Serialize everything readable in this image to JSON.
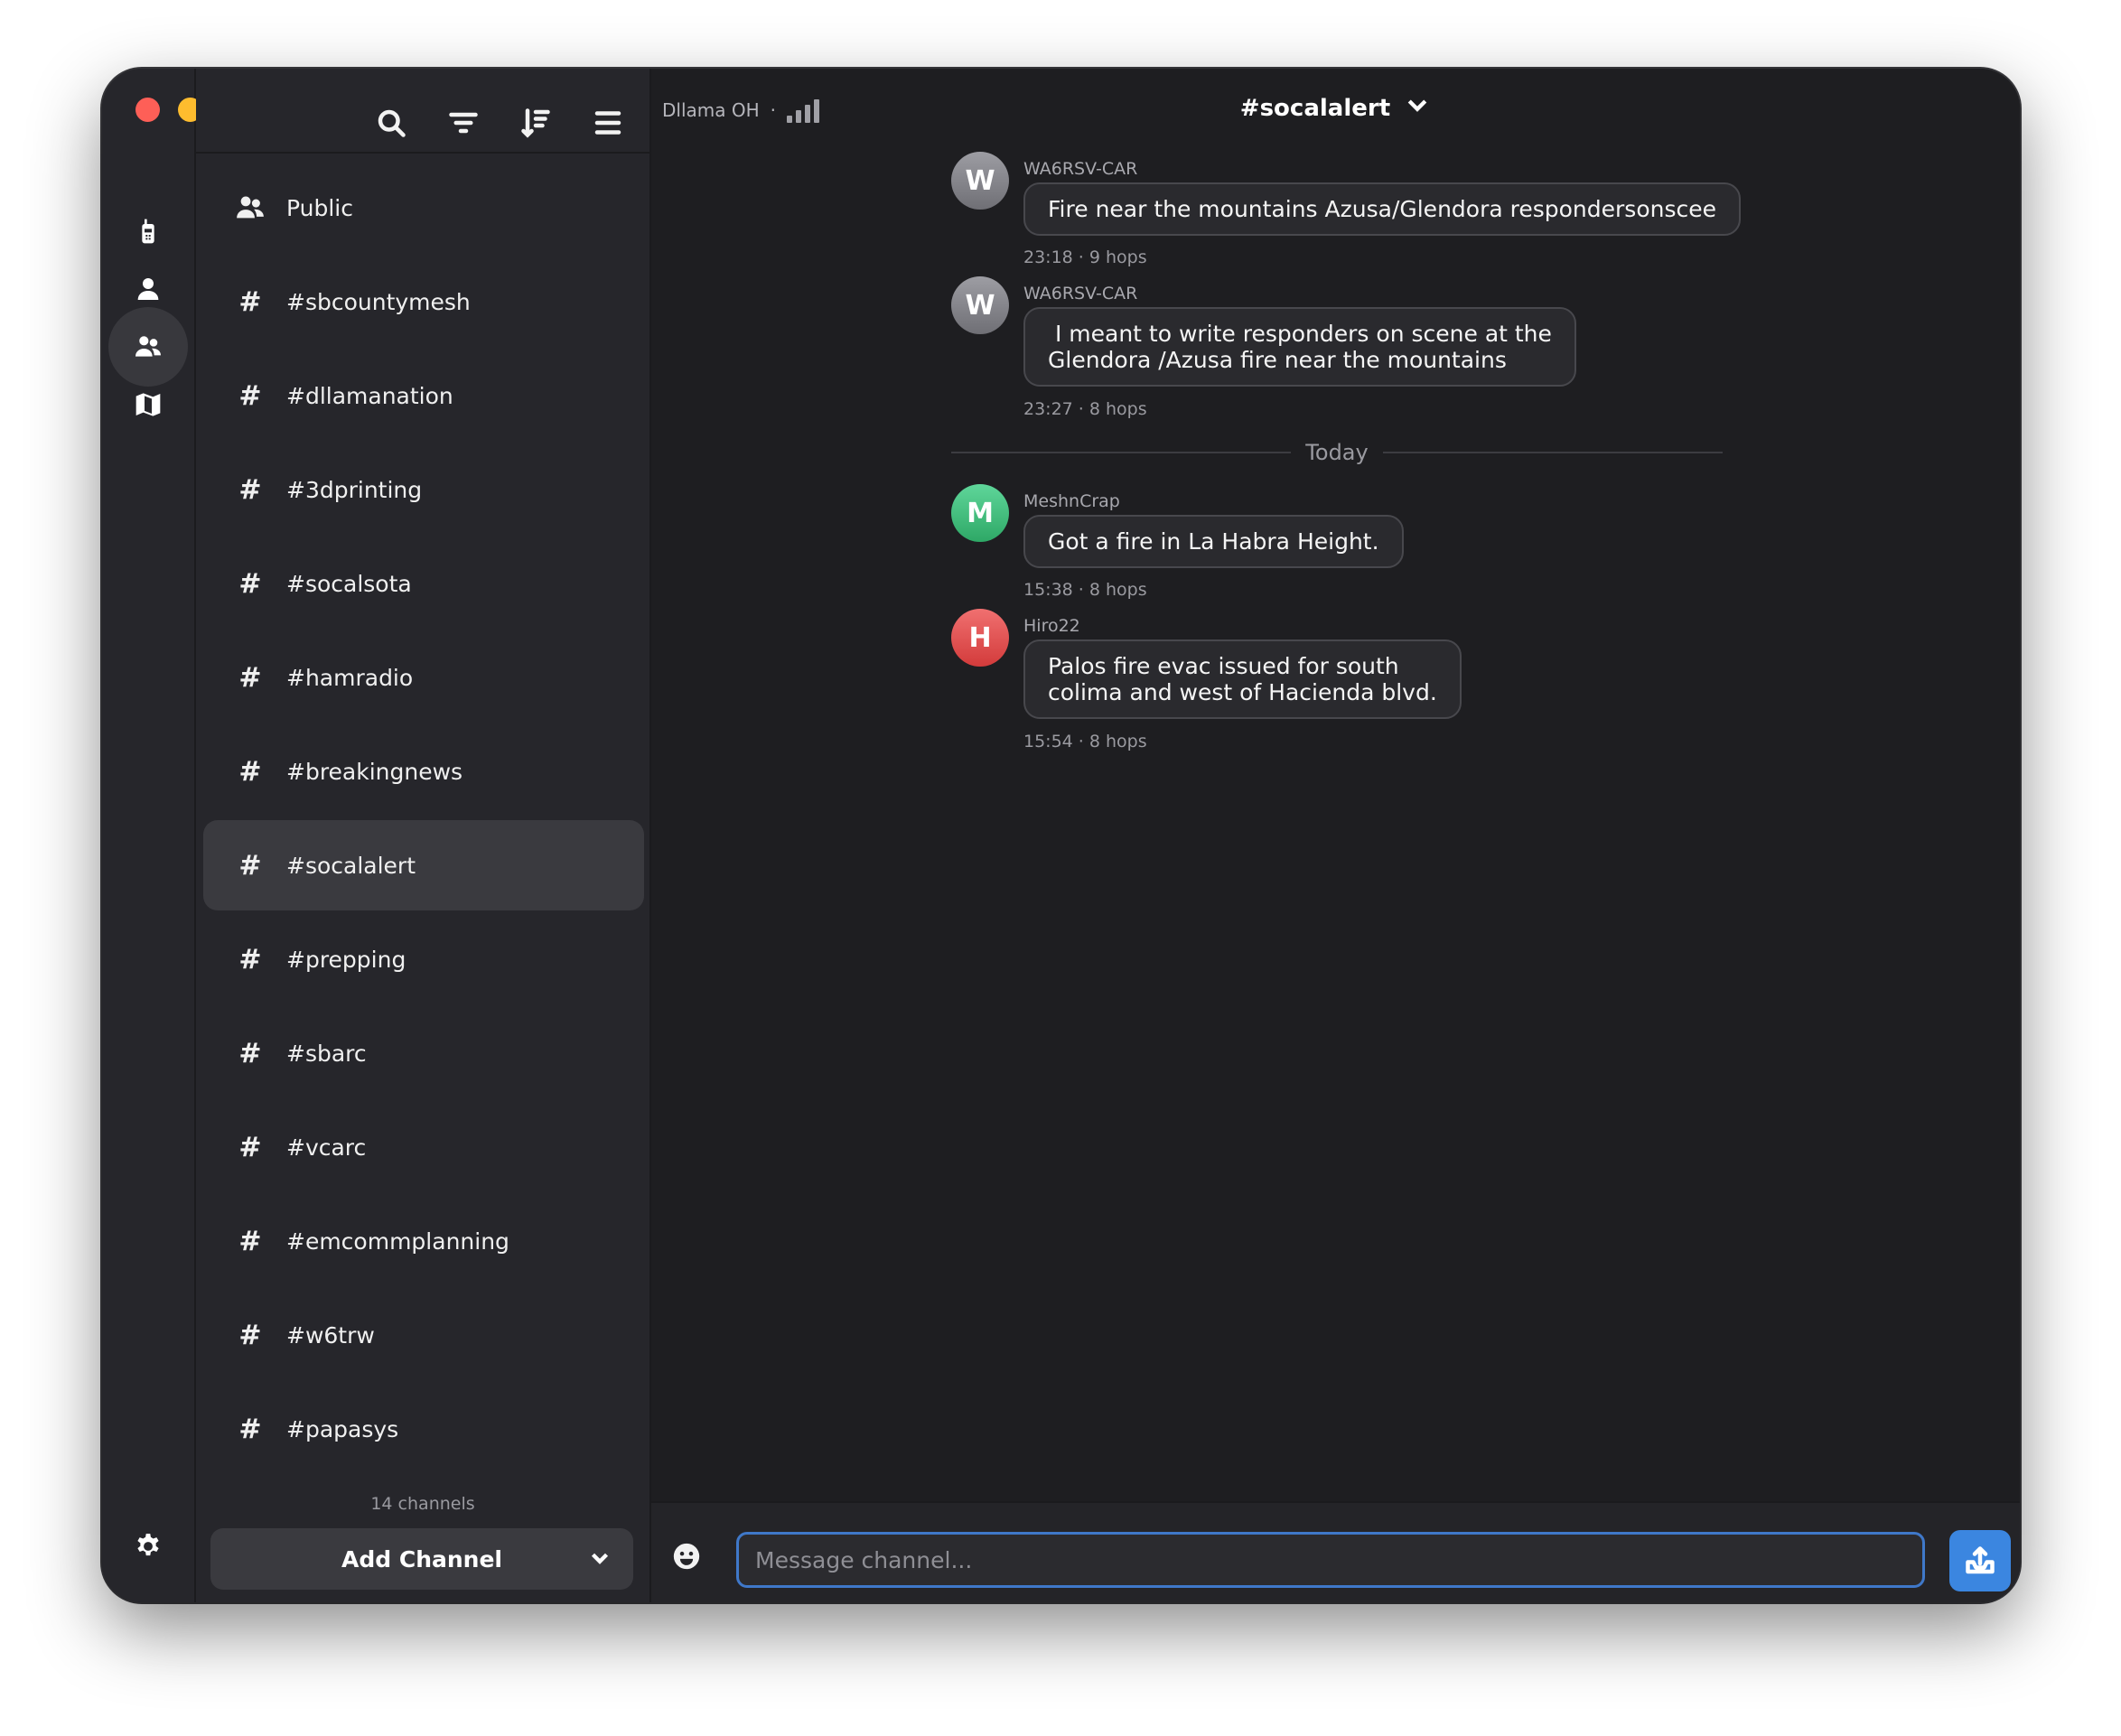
{
  "window": {
    "traffic_lights": [
      "close",
      "minimize",
      "zoom"
    ]
  },
  "rail": {
    "items": [
      {
        "icon": "radio-device-icon",
        "active": false
      },
      {
        "icon": "contact-icon",
        "active": false
      },
      {
        "icon": "channels-icon",
        "active": true
      },
      {
        "icon": "map-icon",
        "active": false
      }
    ],
    "settings_icon": "gear-icon"
  },
  "sidebar": {
    "tools": [
      "search-icon",
      "filter-icon",
      "sort-icon",
      "menu-icon"
    ],
    "channels": [
      {
        "label": "Public",
        "icon": "group-icon",
        "active": false
      },
      {
        "label": "#sbcountymesh",
        "icon": "hash-icon",
        "active": false
      },
      {
        "label": "#dllamanation",
        "icon": "hash-icon",
        "active": false
      },
      {
        "label": "#3dprinting",
        "icon": "hash-icon",
        "active": false
      },
      {
        "label": "#socalsota",
        "icon": "hash-icon",
        "active": false
      },
      {
        "label": "#hamradio",
        "icon": "hash-icon",
        "active": false
      },
      {
        "label": "#breakingnews",
        "icon": "hash-icon",
        "active": false
      },
      {
        "label": "#socalalert",
        "icon": "hash-icon",
        "active": true
      },
      {
        "label": "#prepping",
        "icon": "hash-icon",
        "active": false
      },
      {
        "label": "#sbarc",
        "icon": "hash-icon",
        "active": false
      },
      {
        "label": "#vcarc",
        "icon": "hash-icon",
        "active": false
      },
      {
        "label": "#emcommplanning",
        "icon": "hash-icon",
        "active": false
      },
      {
        "label": "#w6trw",
        "icon": "hash-icon",
        "active": false
      },
      {
        "label": "#papasys",
        "icon": "hash-icon",
        "active": false
      }
    ],
    "count_label": "14 channels",
    "add_channel_label": "Add Channel"
  },
  "header": {
    "node_name": "Dllama OH",
    "separator": "·",
    "signal_icon": "signal-bars-icon",
    "channel_title": "#socalalert"
  },
  "messages": [
    {
      "initial": "W",
      "sender": "WA6RSV-CAR",
      "text": "Fire near the mountains Azusa/Glendora respondersonscee",
      "meta": "23:18 · 9 hops",
      "color": "#8a8a90"
    },
    {
      "initial": "W",
      "sender": "WA6RSV-CAR",
      "text": " I meant to write responders on scene at the\nGlendora /Azusa fire near the mountains",
      "meta": "23:27 · 8 hops",
      "color": "#8a8a90"
    },
    {
      "initial": "M",
      "sender": "MeshnCrap",
      "text": "Got a fire in La Habra Height.",
      "meta": "15:38 · 8 hops",
      "color": "#3fbf7f"
    },
    {
      "initial": "H",
      "sender": "Hiro22",
      "text": "Palos fire evac issued for south\ncolima and west of Hacienda blvd.",
      "meta": "15:54 · 8 hops",
      "color": "#e24b4b"
    }
  ],
  "divider_label": "Today",
  "composer": {
    "placeholder": "Message channel...",
    "value": "",
    "emoji_icon": "emoji-icon",
    "send_icon": "send-icon"
  },
  "colors": {
    "accent": "#3b86e0",
    "input_border": "#3f78c9",
    "bg": "#1e1e21",
    "sidebar_bg": "#26262b"
  }
}
